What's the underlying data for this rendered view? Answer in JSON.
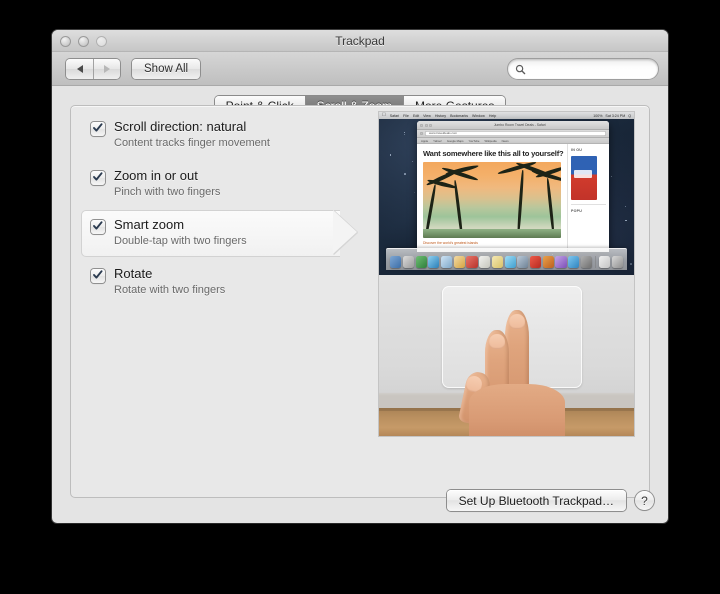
{
  "window": {
    "title": "Trackpad",
    "traffic_lights": [
      "close",
      "minimize",
      "zoom"
    ]
  },
  "toolbar": {
    "back_icon": "triangle-left-icon",
    "forward_icon": "triangle-right-icon",
    "show_all_label": "Show All",
    "search": {
      "value": "",
      "placeholder": "",
      "icon": "search-icon"
    }
  },
  "tabs": [
    {
      "label": "Point & Click",
      "active": false
    },
    {
      "label": "Scroll & Zoom",
      "active": true
    },
    {
      "label": "More Gestures",
      "active": false
    }
  ],
  "options": [
    {
      "title": "Scroll direction: natural",
      "subtitle": "Content tracks finger movement",
      "checked": true,
      "selected": false
    },
    {
      "title": "Zoom in or out",
      "subtitle": "Pinch with two fingers",
      "checked": true,
      "selected": false
    },
    {
      "title": "Smart zoom",
      "subtitle": "Double-tap with two fingers",
      "checked": true,
      "selected": true
    },
    {
      "title": "Rotate",
      "subtitle": "Rotate with two fingers",
      "checked": true,
      "selected": false
    }
  ],
  "preview": {
    "top_scene": "mac-desktop-with-safari",
    "bottom_scene": "hand-double-tapping-magic-trackpad",
    "menubar": {
      "apple": "",
      "items": [
        "Safari",
        "File",
        "Edit",
        "View",
        "History",
        "Bookmarks",
        "Window",
        "Help"
      ],
      "right_items": [
        "100%",
        "Sat 3:24 PM",
        "Q"
      ]
    },
    "safari": {
      "window_title": "Jumbo Room Travel Deals - Safari",
      "url": "www.traveldeals.com",
      "tabs": [
        "Apple",
        "Yahoo!",
        "Google Maps",
        "YouTube",
        "Wikipedia",
        "News"
      ],
      "headline": "Want somewhere like this all to yourself?",
      "caption": "Discover the world's greatest islands",
      "sidebar_headings": [
        "IN OU",
        "POPU"
      ]
    }
  },
  "footer": {
    "setup_button_label": "Set Up Bluetooth Trackpad…",
    "help_label": "?"
  },
  "colors": {
    "window_bg": "#e4e4e4",
    "panel_bg": "#e8e8e8",
    "active_tab_bg": "#7e7e7e",
    "desktop": "#15212f"
  }
}
